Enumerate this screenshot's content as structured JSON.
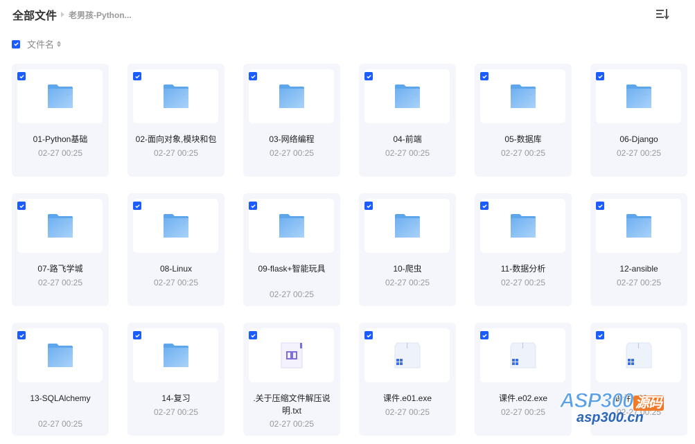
{
  "header": {
    "title": "全部文件",
    "breadcrumb": "老男孩-Python...",
    "sort_icon": "sort-list-icon"
  },
  "column_header": {
    "label": "文件名",
    "checked": true
  },
  "accent": "#1a5cff",
  "files": [
    {
      "name": "01-Python基础",
      "date": "02-27 00:25",
      "type": "folder"
    },
    {
      "name": "02-面向对象,模块和包",
      "date": "02-27 00:25",
      "type": "folder"
    },
    {
      "name": "03-网络编程",
      "date": "02-27 00:25",
      "type": "folder"
    },
    {
      "name": "04-前端",
      "date": "02-27 00:25",
      "type": "folder"
    },
    {
      "name": "05-数据库",
      "date": "02-27 00:25",
      "type": "folder"
    },
    {
      "name": "06-Django",
      "date": "02-27 00:25",
      "type": "folder"
    },
    {
      "name": "07-路飞学城",
      "date": "02-27 00:25",
      "type": "folder"
    },
    {
      "name": "08-Linux",
      "date": "02-27 00:25",
      "type": "folder"
    },
    {
      "name": "09-flask+智能玩具",
      "date": "02-27 00:25",
      "type": "folder"
    },
    {
      "name": "10-爬虫",
      "date": "02-27 00:25",
      "type": "folder"
    },
    {
      "name": "11-数据分析",
      "date": "02-27 00:25",
      "type": "folder"
    },
    {
      "name": "12-ansible",
      "date": "02-27 00:25",
      "type": "folder"
    },
    {
      "name": "13-SQLAlchemy",
      "date": "02-27 00:25",
      "type": "folder"
    },
    {
      "name": "14-复习",
      "date": "02-27 00:25",
      "type": "folder"
    },
    {
      "name": ".关于压缩文件解压说明.txt",
      "date": "02-27 00:25",
      "type": "txt"
    },
    {
      "name": "课件.e01.exe",
      "date": "02-27 00:25",
      "type": "exe"
    },
    {
      "name": "课件.e02.exe",
      "date": "02-27 00:25",
      "type": "exe"
    },
    {
      "name": "课件.e03.exe",
      "date": "02-27 00:25",
      "type": "exe"
    }
  ],
  "watermark": {
    "logo": "ASP300",
    "logo_tag": "源码",
    "site": "asp300.cn"
  }
}
